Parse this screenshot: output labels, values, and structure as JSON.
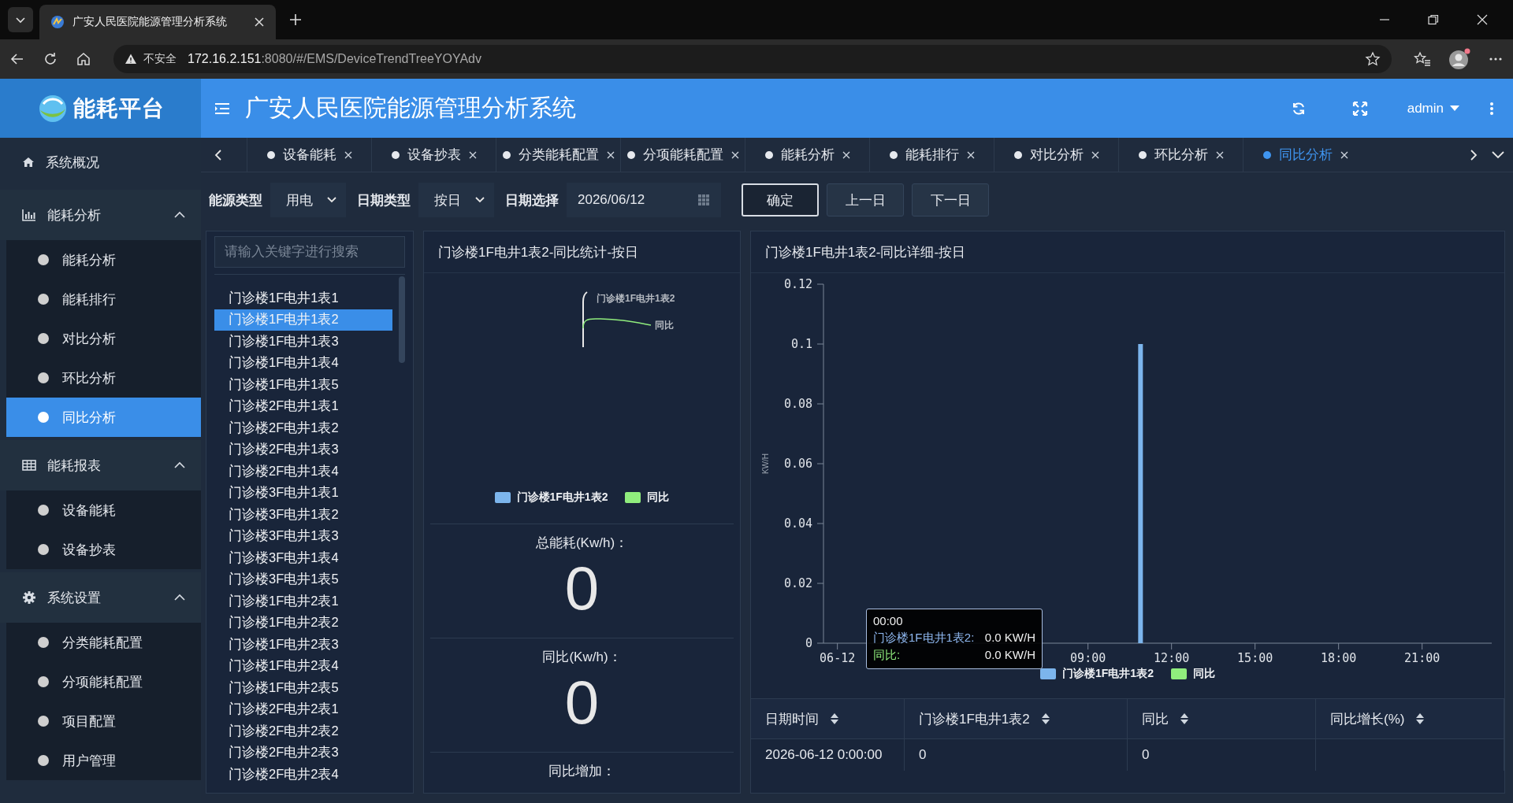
{
  "browser": {
    "tab_title": "广安人民医院能源管理分析系统",
    "security_label": "不安全",
    "url_host": "172.16.2.151",
    "url_path": ":8080/#/EMS/DeviceTrendTreeYOYAdv"
  },
  "header": {
    "logo_text": "能耗平台",
    "title": "广安人民医院能源管理分析系统",
    "user": "admin"
  },
  "sidebar": {
    "items": [
      {
        "label": "系统概况",
        "kind": "link"
      },
      {
        "label": "能耗分析",
        "kind": "group",
        "expanded": true,
        "children": [
          {
            "label": "能耗分析",
            "selected": false
          },
          {
            "label": "能耗排行",
            "selected": false
          },
          {
            "label": "对比分析",
            "selected": false
          },
          {
            "label": "环比分析",
            "selected": false
          },
          {
            "label": "同比分析",
            "selected": true
          }
        ]
      },
      {
        "label": "能耗报表",
        "kind": "group",
        "expanded": true,
        "children": [
          {
            "label": "设备能耗",
            "selected": false
          },
          {
            "label": "设备抄表",
            "selected": false
          }
        ]
      },
      {
        "label": "系统设置",
        "kind": "group",
        "expanded": true,
        "children": [
          {
            "label": "分类能耗配置",
            "selected": false
          },
          {
            "label": "分项能耗配置",
            "selected": false
          },
          {
            "label": "项目配置",
            "selected": false
          },
          {
            "label": "用户管理",
            "selected": false
          }
        ]
      }
    ]
  },
  "tabs": [
    {
      "label": "设备能耗",
      "selected": false
    },
    {
      "label": "设备抄表",
      "selected": false
    },
    {
      "label": "分类能耗配置",
      "selected": false
    },
    {
      "label": "分项能耗配置",
      "selected": false
    },
    {
      "label": "能耗分析",
      "selected": false
    },
    {
      "label": "能耗排行",
      "selected": false
    },
    {
      "label": "对比分析",
      "selected": false
    },
    {
      "label": "环比分析",
      "selected": false
    },
    {
      "label": "同比分析",
      "selected": true
    }
  ],
  "filters": {
    "energy_type": {
      "label": "能源类型",
      "value": "用电"
    },
    "date_type": {
      "label": "日期类型",
      "value": "按日"
    },
    "date": {
      "label": "日期选择",
      "value": "2026/06/12"
    },
    "buttons": [
      {
        "label": "确定",
        "kind": "primary"
      },
      {
        "label": "上一日",
        "kind": "plain"
      },
      {
        "label": "下一日",
        "kind": "plain"
      }
    ]
  },
  "tree": {
    "placeholder": "请输入关键字进行搜索",
    "items": [
      {
        "label": "门诊楼1F电井1表1",
        "selected": false
      },
      {
        "label": "门诊楼1F电井1表2",
        "selected": true
      },
      {
        "label": "门诊楼1F电井1表3",
        "selected": false
      },
      {
        "label": "门诊楼1F电井1表4",
        "selected": false
      },
      {
        "label": "门诊楼1F电井1表5",
        "selected": false
      },
      {
        "label": "门诊楼2F电井1表1",
        "selected": false
      },
      {
        "label": "门诊楼2F电井1表2",
        "selected": false
      },
      {
        "label": "门诊楼2F电井1表3",
        "selected": false
      },
      {
        "label": "门诊楼2F电井1表4",
        "selected": false
      },
      {
        "label": "门诊楼3F电井1表1",
        "selected": false
      },
      {
        "label": "门诊楼3F电井1表2",
        "selected": false
      },
      {
        "label": "门诊楼3F电井1表3",
        "selected": false
      },
      {
        "label": "门诊楼3F电井1表4",
        "selected": false
      },
      {
        "label": "门诊楼3F电井1表5",
        "selected": false
      },
      {
        "label": "门诊楼1F电井2表1",
        "selected": false
      },
      {
        "label": "门诊楼1F电井2表2",
        "selected": false
      },
      {
        "label": "门诊楼1F电井2表3",
        "selected": false
      },
      {
        "label": "门诊楼1F电井2表4",
        "selected": false
      },
      {
        "label": "门诊楼1F电井2表5",
        "selected": false
      },
      {
        "label": "门诊楼2F电井2表1",
        "selected": false
      },
      {
        "label": "门诊楼2F电井2表2",
        "selected": false
      },
      {
        "label": "门诊楼2F电井2表3",
        "selected": false
      },
      {
        "label": "门诊楼2F电井2表4",
        "selected": false
      }
    ]
  },
  "summary": {
    "title": "门诊楼1F电井1表2-同比统计-按日",
    "pie_labels": [
      "门诊楼1F电井1表2",
      "同比"
    ],
    "legend": [
      {
        "name": "门诊楼1F电井1表2",
        "color": "#7cb5ec"
      },
      {
        "name": "同比",
        "color": "#90ed7d"
      }
    ],
    "stats": [
      {
        "label": "总能耗(Kw/h)：",
        "value": "0"
      },
      {
        "label": "同比(Kw/h)：",
        "value": "0"
      },
      {
        "label": "同比增加："
      }
    ]
  },
  "detail": {
    "title": "门诊楼1F电井1表2-同比详细-按日",
    "chart_data": {
      "type": "bar",
      "ylabel": "KW/H",
      "x": [
        0,
        1,
        2,
        3,
        4,
        5,
        6,
        7,
        8,
        9,
        10,
        11,
        12,
        13,
        14,
        15,
        16,
        17,
        18,
        19,
        20,
        21,
        22,
        23
      ],
      "xlim": [
        -0.5,
        23.5
      ],
      "series": [
        {
          "name": "门诊楼1F电井1表2",
          "color": "#7cb5ec",
          "values": [
            0,
            0,
            0,
            0,
            0,
            0,
            0,
            0,
            0,
            0,
            0,
            0.1,
            0,
            0,
            0,
            0,
            0,
            0,
            0,
            0,
            0,
            0,
            0,
            0
          ]
        },
        {
          "name": "同比",
          "color": "#90ed7d",
          "values": [
            0,
            0,
            0,
            0,
            0,
            0,
            0,
            0,
            0,
            0,
            0,
            0,
            0,
            0,
            0,
            0,
            0,
            0,
            0,
            0,
            0,
            0,
            0,
            0
          ]
        }
      ],
      "ylim": [
        0,
        0.12
      ],
      "yticks": [
        0,
        0.02,
        0.04,
        0.06,
        0.08,
        0.1,
        0.12
      ],
      "xticks": [
        {
          "value": 0,
          "label": "06-12"
        },
        {
          "value": 9,
          "label": "09:00"
        },
        {
          "value": 12,
          "label": "12:00"
        },
        {
          "value": 15,
          "label": "15:00"
        },
        {
          "value": 18,
          "label": "18:00"
        },
        {
          "value": 21,
          "label": "21:00"
        }
      ]
    },
    "tooltip": {
      "time": "00:00",
      "rows": [
        {
          "name": "门诊楼1F电井1表2:",
          "value": "0.0 KW/H",
          "color": "#8fb8f0"
        },
        {
          "name": "同比:",
          "value": "0.0 KW/H",
          "color": "#90ed7d"
        }
      ]
    },
    "table": {
      "columns": [
        "日期时间",
        "门诊楼1F电井1表2",
        "同比",
        "同比增长(%)"
      ],
      "rows": [
        [
          "2026-06-12 0:00:00",
          "0",
          "0"
        ]
      ]
    }
  }
}
